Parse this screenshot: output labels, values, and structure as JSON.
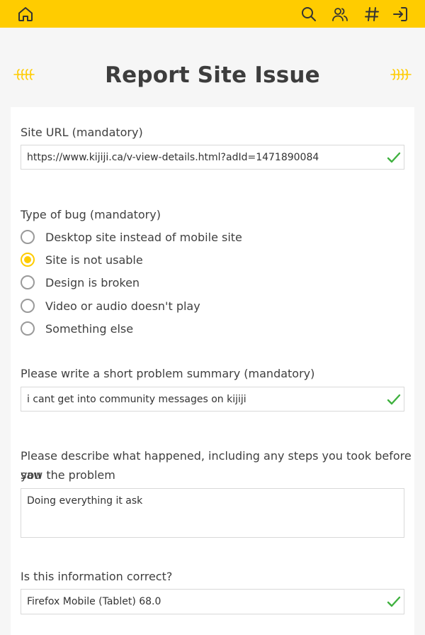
{
  "nav": {
    "icons": [
      "home-icon",
      "search-icon",
      "users-icon",
      "hashtag-icon",
      "login-icon"
    ]
  },
  "page": {
    "title": "Report Site Issue"
  },
  "form": {
    "site_url": {
      "label": "Site URL (mandatory)",
      "value": "https://www.kijiji.ca/v-view-details.html?adId=1471890084"
    },
    "bug_type": {
      "label": "Type of bug (mandatory)",
      "options": [
        {
          "label": "Desktop site instead of mobile site",
          "checked": false
        },
        {
          "label": "Site is not usable",
          "checked": true
        },
        {
          "label": "Design is broken",
          "checked": false
        },
        {
          "label": "Video or audio doesn't play",
          "checked": false
        },
        {
          "label": "Something else",
          "checked": false
        }
      ]
    },
    "summary": {
      "label": "Please write a short problem summary (mandatory)",
      "value": "i cant get into community  messages on kijiji"
    },
    "description": {
      "label_line1": "Please describe what happened, including any steps you took before you",
      "label_line2": "saw the problem",
      "value": "Doing everything  it ask"
    },
    "browser_info": {
      "label": "Is this information correct?",
      "value": "Firefox Mobile (Tablet) 68.0"
    }
  },
  "colors": {
    "accent": "#ffcc00",
    "check": "#3fb13f",
    "background": "#f6f6f6"
  }
}
